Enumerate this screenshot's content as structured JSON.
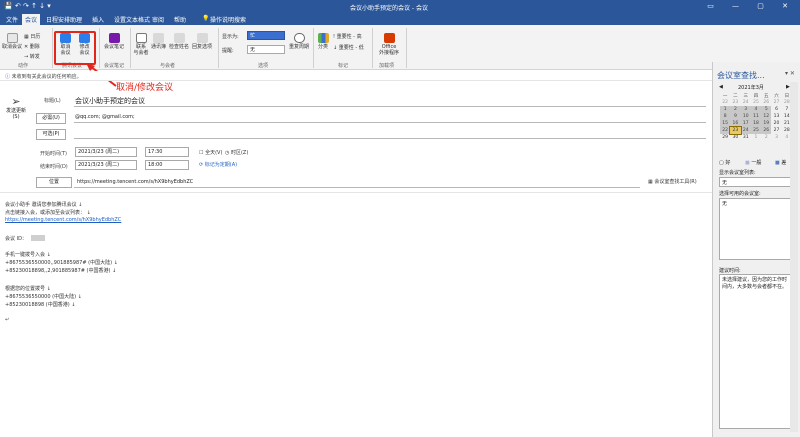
{
  "titlebar": {
    "title": "会议小助手预定的会议 - 会议",
    "qat": "💾 ↶ ↷ ↑ ↓ ▾",
    "win_controls": "▭ — ▢ ✕"
  },
  "tabs": [
    "文件",
    "会议",
    "日程安排助理",
    "插入",
    "设置文本格式",
    "审阅",
    "帮助"
  ],
  "tabs_extra": [
    "插入"
  ],
  "search_tab": "操作说明搜索",
  "ribbon": {
    "actions": {
      "cancel_meeting": "取消会议",
      "copy_to": "转发",
      "delete": "删除",
      "group": "动作"
    },
    "tencent": {
      "cancel": "取消\n会议",
      "modify": "修改\n会议",
      "group": "腾讯会议"
    },
    "onenote": {
      "label": "会议笔记",
      "group": "会议笔记"
    },
    "attendees": {
      "contact": "联系\n与会者",
      "address": "通讯簿",
      "check": "检查姓名",
      "response": "回复选项",
      "group": "与会者"
    },
    "options": {
      "show_as_label": "显示为:",
      "show_as_value": "忙",
      "reminder_label": "提醒:",
      "reminder_value": "无",
      "recurrence": "重复周期",
      "group": "选项"
    },
    "tags": {
      "category": "分类",
      "high": "重要性 - 高",
      "low": "重要性 - 低",
      "group": "标记"
    },
    "addins": {
      "office": "Office\n外接程序",
      "group": "加载项"
    }
  },
  "infobar": "未收到有关此会议的任何响应。",
  "form": {
    "send_update": "发送更新(S)",
    "title_label": "标题(L)",
    "title_value": "会议小助手预定的会议",
    "required_btn": "必需(U)",
    "required_value": "@qq.com;            @gmail.com;",
    "optional_btn": "可选(P)",
    "start_label": "开始时间(T)",
    "start_date": "2021/3/23 (周二)",
    "start_time": "17:30",
    "end_label": "结束时间(D)",
    "end_date": "2021/3/23 (周二)",
    "end_time": "18:00",
    "all_day": "全天(V)",
    "timezone": "时区(Z)",
    "make_recurring": "标记为定期(A)",
    "location_btn": "位置",
    "location_value": "https://meeting.tencent.com/s/hX9bhyEdbhZC",
    "room_finder": "会议室查找工具(R)"
  },
  "body_lines": [
    "会议小助手 邀请您参加腾讯会议 ↓",
    "点击链接入会，或添加至会议列表： ↓",
    "https://meeting.tencent.com/s/hX9bhyEdbhZC",
    "会议 ID：",
    "手机一键拨号入会 ↓",
    "+8675536550000,,901885987# (中国大陆) ↓",
    "+85230018898,,2,901885987# (中国香港) ↓",
    "根据您的位置拨号 ↓",
    "+8675536550000 (中国大陆) ↓",
    "+85230018898 (中国香港) ↓",
    "↵"
  ],
  "annotation": "取消/修改会议",
  "pane": {
    "title": "会议室查找...",
    "month": "2021年3月",
    "weekdays": [
      "一",
      "二",
      "三",
      "四",
      "五",
      "六",
      "日"
    ],
    "weeks": [
      [
        "22",
        "23",
        "24",
        "25",
        "26",
        "27",
        "28"
      ],
      [
        "1",
        "2",
        "3",
        "4",
        "5",
        "6",
        "7"
      ],
      [
        "8",
        "9",
        "10",
        "11",
        "12",
        "13",
        "14"
      ],
      [
        "15",
        "16",
        "17",
        "18",
        "19",
        "20",
        "21"
      ],
      [
        "22",
        "23",
        "24",
        "25",
        "26",
        "27",
        "28"
      ],
      [
        "29",
        "30",
        "31",
        "1",
        "2",
        "3",
        "4"
      ]
    ],
    "legend": [
      "好",
      "一般",
      "差"
    ],
    "room_list_label": "显示会议室列表:",
    "room_list_value": "无",
    "choose_room_label": "选择可用的会议室:",
    "room_value": "无",
    "suggest_label": "建议时间:",
    "suggest_text": "未选择建议，因为您的工作时间内，大多数与会者都不在。"
  },
  "colors": {
    "brand": "#2b579a",
    "annotation": "#e1261c",
    "selected_day": "#e8c96a"
  }
}
